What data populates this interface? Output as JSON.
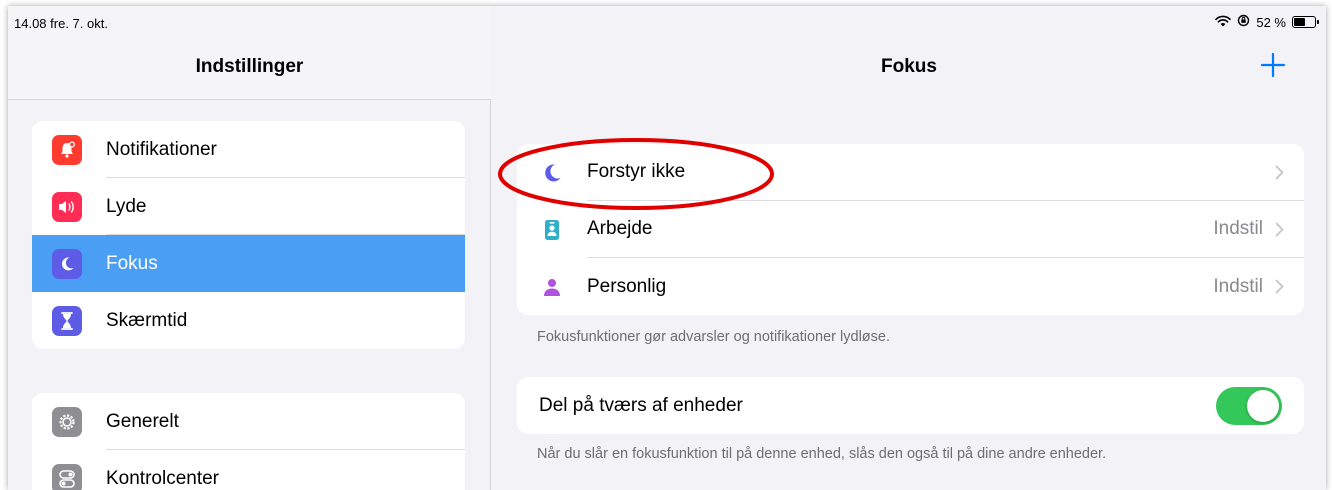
{
  "status_bar": {
    "time_date": "14.08  fre. 7. okt.",
    "battery_text": "52 %",
    "battery_level": 0.52
  },
  "sidebar": {
    "title": "Indstillinger",
    "group1": [
      {
        "label": "Notifikationer",
        "icon": "bell-icon",
        "color": "#ff3b30"
      },
      {
        "label": "Lyde",
        "icon": "speaker-icon",
        "color": "#ff2d55"
      },
      {
        "label": "Fokus",
        "icon": "moon-icon",
        "color": "#5e5ce6",
        "selected": true
      },
      {
        "label": "Skærmtid",
        "icon": "hourglass-icon",
        "color": "#5e5ce6"
      }
    ],
    "group2": [
      {
        "label": "Generelt",
        "icon": "gear-icon",
        "color": "#8e8e93"
      },
      {
        "label": "Kontrolcenter",
        "icon": "switches-icon",
        "color": "#8e8e93"
      }
    ]
  },
  "detail": {
    "title": "Fokus",
    "focus_modes": [
      {
        "label": "Forstyr ikke",
        "value": "",
        "icon": "moon-icon",
        "color": "#5e5ce6"
      },
      {
        "label": "Arbejde",
        "value": "Indstil",
        "icon": "id-badge-icon",
        "color": "#30b0c7"
      },
      {
        "label": "Personlig",
        "value": "Indstil",
        "icon": "person-icon",
        "color": "#af52de"
      }
    ],
    "focus_footnote": "Fokusfunktioner gør advarsler og notifikationer lydløse.",
    "share": {
      "label": "Del på tværs af enheder",
      "on": true,
      "footnote": "Når du slår en fokusfunktion til på denne enhed, slås den også til på dine andre enheder."
    }
  },
  "colors": {
    "accent": "#007aff",
    "selection": "#4a9ff5",
    "toggle_on": "#34c759",
    "annotation": "#e00000"
  }
}
